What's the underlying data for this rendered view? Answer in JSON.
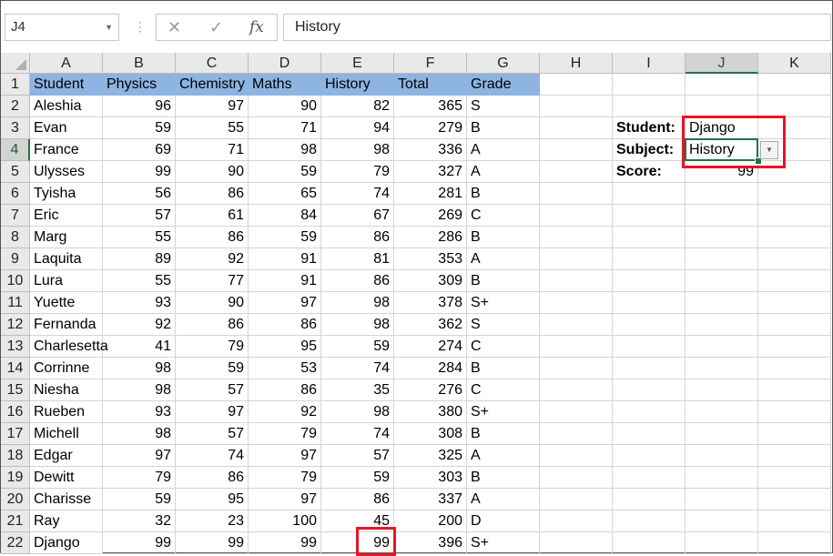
{
  "formula_bar": {
    "name_box": "J4",
    "fx_label": "fx",
    "formula": "History"
  },
  "columns": [
    "A",
    "B",
    "C",
    "D",
    "E",
    "F",
    "G",
    "H",
    "I",
    "J",
    "K"
  ],
  "active": {
    "column": "J",
    "row": 4
  },
  "table": {
    "headers": [
      "Student",
      "Physics",
      "Chemistry",
      "Maths",
      "History",
      "Total",
      "Grade"
    ],
    "rows": [
      [
        "Aleshia",
        96,
        97,
        90,
        82,
        365,
        "S"
      ],
      [
        "Evan",
        59,
        55,
        71,
        94,
        279,
        "B"
      ],
      [
        "France",
        69,
        71,
        98,
        98,
        336,
        "A"
      ],
      [
        "Ulysses",
        99,
        90,
        59,
        79,
        327,
        "A"
      ],
      [
        "Tyisha",
        56,
        86,
        65,
        74,
        281,
        "B"
      ],
      [
        "Eric",
        57,
        61,
        84,
        67,
        269,
        "C"
      ],
      [
        "Marg",
        55,
        86,
        59,
        86,
        286,
        "B"
      ],
      [
        "Laquita",
        89,
        92,
        91,
        81,
        353,
        "A"
      ],
      [
        "Lura",
        55,
        77,
        91,
        86,
        309,
        "B"
      ],
      [
        "Yuette",
        93,
        90,
        97,
        98,
        378,
        "S+"
      ],
      [
        "Fernanda",
        92,
        86,
        86,
        98,
        362,
        "S"
      ],
      [
        "Charlesetta",
        41,
        79,
        95,
        59,
        274,
        "C"
      ],
      [
        "Corrinne",
        98,
        59,
        53,
        74,
        284,
        "B"
      ],
      [
        "Niesha",
        98,
        57,
        86,
        35,
        276,
        "C"
      ],
      [
        "Rueben",
        93,
        97,
        92,
        98,
        380,
        "S+"
      ],
      [
        "Michell",
        98,
        57,
        79,
        74,
        308,
        "B"
      ],
      [
        "Edgar",
        97,
        74,
        97,
        57,
        325,
        "A"
      ],
      [
        "Dewitt",
        79,
        86,
        79,
        59,
        303,
        "B"
      ],
      [
        "Charisse",
        59,
        95,
        97,
        86,
        337,
        "A"
      ],
      [
        "Ray",
        32,
        23,
        100,
        45,
        200,
        "D"
      ],
      [
        "Django",
        99,
        99,
        99,
        99,
        396,
        "S+"
      ]
    ]
  },
  "lookup": {
    "student_label": "Student:",
    "student_value": "Django",
    "subject_label": "Subject:",
    "subject_value": "History",
    "score_label": "Score:",
    "score_value": "99"
  },
  "colors": {
    "header_fill": "#8db4e2",
    "highlight_red": "#e3162b",
    "active_green": "#217346"
  }
}
